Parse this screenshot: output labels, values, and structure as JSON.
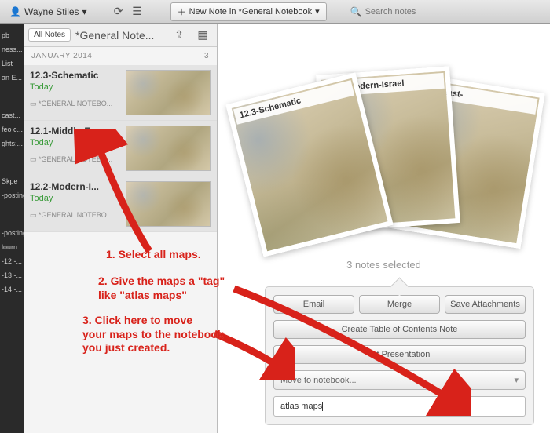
{
  "toolbar": {
    "user": "Wayne Stiles",
    "new_note_label": "New Note in *General Notebook",
    "search_placeholder": "Search notes"
  },
  "sidebar_items": [
    "pb",
    "ness...",
    "List",
    "an E...",
    "cast...",
    "feo c...",
    "ghts:...",
    "Skpe",
    "-posting",
    "-posting",
    "lourn...",
    "-12 -...",
    "-13 -...",
    "-14 -..."
  ],
  "notelist": {
    "all_notes_label": "All Notes",
    "notebook_title": "*General Note...",
    "month_label": "JANUARY 2014",
    "month_count": "3",
    "notes": [
      {
        "title": "12.3-Schematic",
        "date": "Today",
        "notebook": "*GENERAL NOTEBO..."
      },
      {
        "title": "12.1-Middle-E...",
        "date": "Today",
        "notebook": "*GENERAL NOTEBO..."
      },
      {
        "title": "12.2-Modern-I...",
        "date": "Today",
        "notebook": "*GENERAL NOTEBO..."
      }
    ]
  },
  "detail": {
    "cards": [
      {
        "label": "12.3-Schematic"
      },
      {
        "label": "12.2-Modern-Israel"
      },
      {
        "label": "ddle-East-"
      }
    ],
    "selected_text": "3 notes selected",
    "buttons": {
      "email": "Email",
      "merge": "Merge",
      "save_attachments": "Save Attachments",
      "create_toc": "Create Table of Contents Note",
      "start_presentation": "art Presentation",
      "move_to": "Move to notebook..."
    },
    "tag_value": "atlas maps"
  },
  "annotations": {
    "a1": "1. Select all maps.",
    "a2": "2. Give the maps a \"tag\"\nlike \"atlas maps\"",
    "a3": "3. Click here to move\nyour maps to the notebook\nyou just created."
  },
  "colors": {
    "annotation_red": "#d8221a",
    "date_green": "#3a9b3a"
  }
}
